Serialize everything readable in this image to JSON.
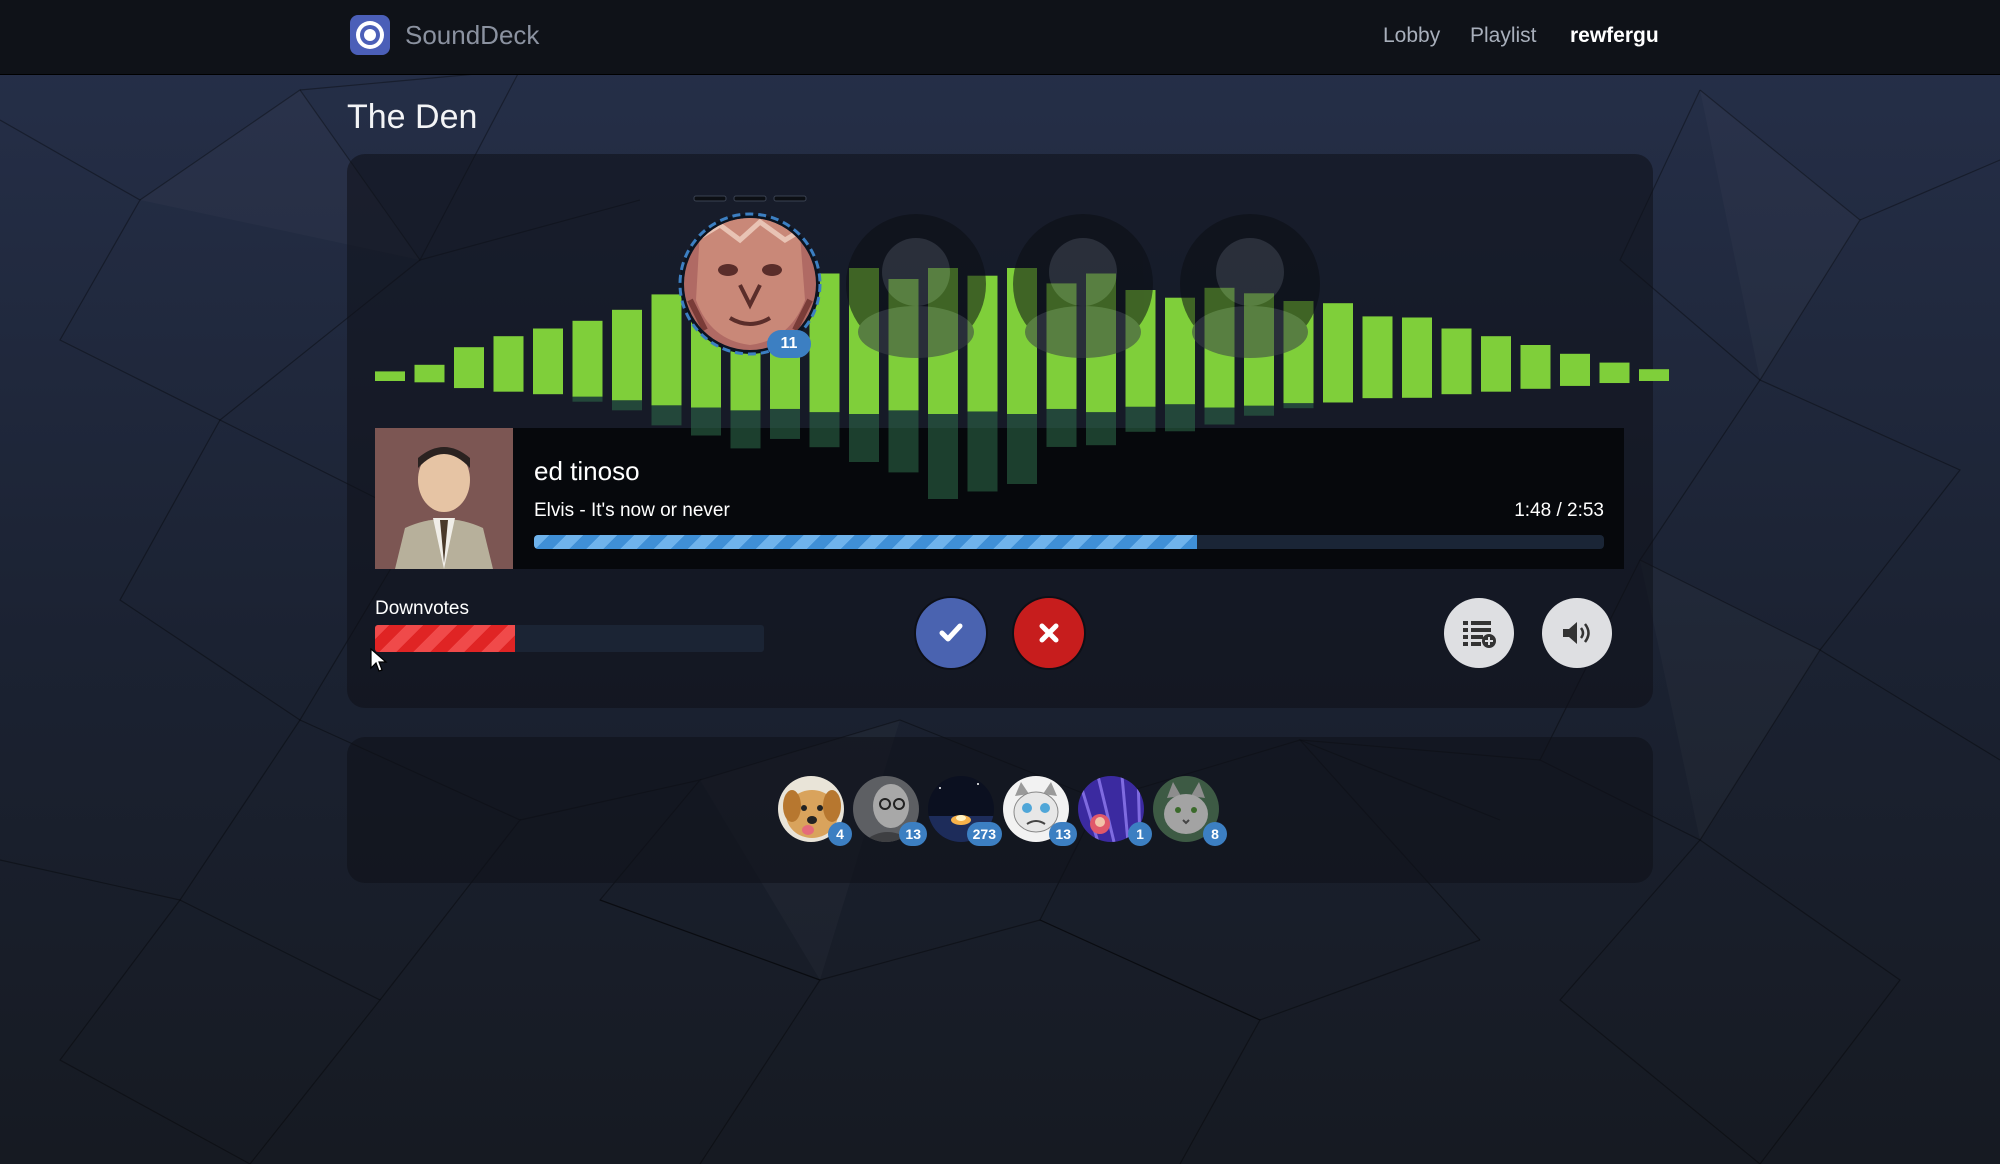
{
  "app": {
    "name": "SoundDeck",
    "nav": {
      "lobby": "Lobby",
      "playlist": "Playlist",
      "user": "rewfergu"
    }
  },
  "room": {
    "title": "The Den"
  },
  "dj_queue": {
    "active_dj_plays": "11",
    "empty_slots": 3
  },
  "visualizer": {
    "bar_levels": [
      0.06,
      0.12,
      0.28,
      0.38,
      0.45,
      0.52,
      0.62,
      0.76,
      0.82,
      0.9,
      0.86,
      0.95,
      1.0,
      0.9,
      1.0,
      0.93,
      1.0,
      0.86,
      0.95,
      0.8,
      0.73,
      0.82,
      0.77,
      0.7,
      0.68,
      0.56,
      0.55,
      0.45,
      0.38,
      0.3,
      0.22,
      0.14,
      0.08
    ],
    "reflection_levels": [
      0.0,
      0.0,
      0.0,
      0.0,
      0.0,
      0.05,
      0.1,
      0.2,
      0.28,
      0.38,
      0.3,
      0.35,
      0.48,
      0.62,
      0.85,
      0.8,
      0.7,
      0.38,
      0.33,
      0.25,
      0.27,
      0.17,
      0.1,
      0.05,
      0.0,
      0.0,
      0.0,
      0.0,
      0.0,
      0.0,
      0.0,
      0.0,
      0.0
    ],
    "colors": {
      "low": "#f5ea3a",
      "mid": "#b8e83a",
      "high": "#e81f1f",
      "orange": "#f59a28"
    }
  },
  "now_playing": {
    "username": "ed tinoso",
    "song": "Elvis - It's now or never",
    "time": "1:48 / 2:53",
    "progress_fraction": 0.62
  },
  "downvotes": {
    "label": "Downvotes",
    "fraction": 0.36
  },
  "controls": {
    "upvote_icon": "check-icon",
    "downvote_icon": "close-icon",
    "add_to_playlist_icon": "playlist-add-icon",
    "volume_icon": "volume-icon"
  },
  "listeners": [
    {
      "avatar": "dog",
      "count": "4"
    },
    {
      "avatar": "man-glasses",
      "count": "13"
    },
    {
      "avatar": "campfire",
      "count": "273"
    },
    {
      "avatar": "grumpy-cat",
      "count": "13"
    },
    {
      "avatar": "purple-girl",
      "count": "1"
    },
    {
      "avatar": "grey-cat",
      "count": "8"
    }
  ],
  "colors": {
    "accent": "#3c7fc2",
    "upvote": "#4a63b0",
    "downvote": "#c71d1d"
  }
}
